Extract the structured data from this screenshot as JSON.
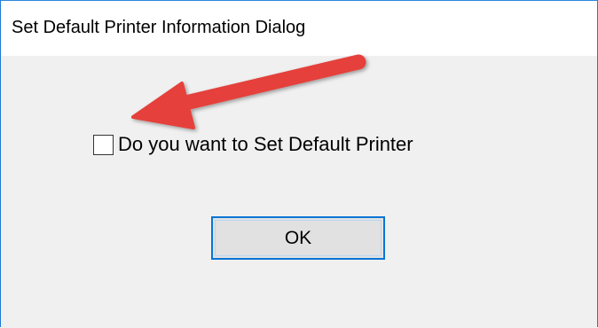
{
  "window": {
    "title": "Set Default Printer Information Dialog",
    "accent_color": "#1e7ad6"
  },
  "dialog": {
    "checkbox": {
      "label": "Do you want to Set Default Printer",
      "checked": false
    },
    "ok_button": {
      "label": "OK"
    }
  },
  "annotation": {
    "icon": "red-arrow-icon",
    "color": "#e5403b"
  }
}
